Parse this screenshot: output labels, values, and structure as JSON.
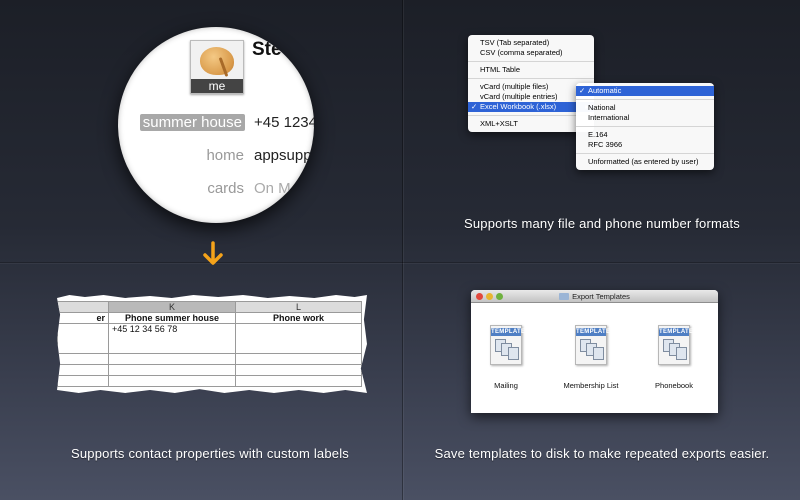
{
  "magnifier": {
    "avatar_label": "me",
    "name_fragment": "Ste",
    "rows": [
      {
        "label": "summer house",
        "value": "+45 1234"
      },
      {
        "label": "home",
        "value": "appsupp"
      },
      {
        "label": "cards",
        "value": "On M"
      }
    ]
  },
  "arrow_color": "#f5a31a",
  "spreadsheet": {
    "column_headers": [
      "",
      "K",
      "L"
    ],
    "field_names": [
      "er",
      "Phone summer house",
      "Phone work"
    ],
    "first_row": [
      "",
      "+45 12 34 56 78",
      ""
    ]
  },
  "format_menu": {
    "items": [
      "TSV (Tab separated)",
      "CSV (comma separated)",
      "HTML Table",
      "vCard (multiple files)",
      "vCard (multiple entries)",
      "Excel Workbook (.xlsx)",
      "XML+XSLT"
    ],
    "selected": "Excel Workbook (.xlsx)"
  },
  "phone_menu": {
    "items": [
      "Automatic",
      "National",
      "International",
      "E.164",
      "RFC 3966",
      "Unformatted (as entered by user)"
    ],
    "selected": "Automatic"
  },
  "window": {
    "title": "Export Templates",
    "icon_badge": "TEMPLATE",
    "templates": [
      {
        "label": "Mailing"
      },
      {
        "label": "Membership List"
      },
      {
        "label": "Phonebook"
      }
    ]
  },
  "captions": {
    "formats": "Supports many file and phone number formats",
    "custom_labels": "Supports contact properties with custom labels",
    "templates": "Save templates to disk to make repeated exports easier."
  }
}
